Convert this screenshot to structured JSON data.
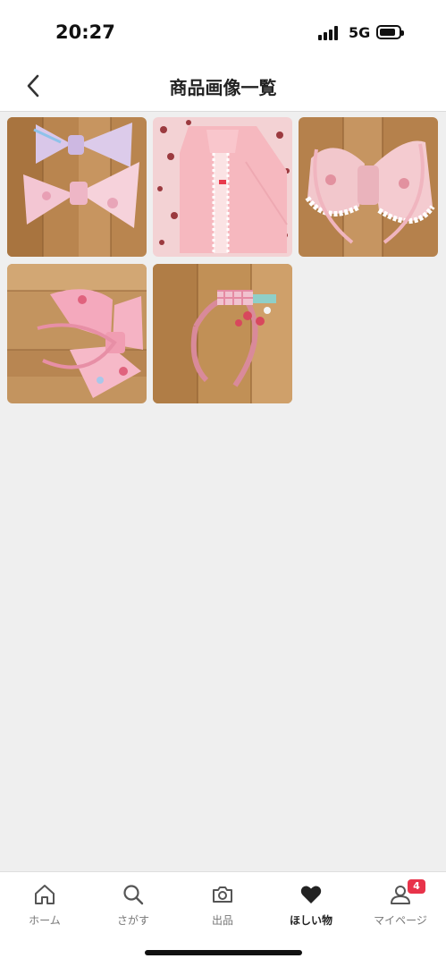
{
  "status_bar": {
    "time": "20:27",
    "network": "5G"
  },
  "header": {
    "title": "商品画像一覧",
    "back_icon": "chevron-left-icon"
  },
  "images": [
    {
      "description": "two pastel pink and lavender bows on wood"
    },
    {
      "description": "pink lace blouse on cherry print fabric"
    },
    {
      "description": "pink floral bow headband with white lace"
    },
    {
      "description": "large pink bow headband with strawberry print"
    },
    {
      "description": "pink gingham headband with strawberries"
    }
  ],
  "tab_bar": {
    "items": [
      {
        "label": "ホーム",
        "icon": "home-icon",
        "active": false
      },
      {
        "label": "さがす",
        "icon": "search-icon",
        "active": false
      },
      {
        "label": "出品",
        "icon": "camera-icon",
        "active": false
      },
      {
        "label": "ほしい物",
        "icon": "heart-icon",
        "active": true
      },
      {
        "label": "マイページ",
        "icon": "user-icon",
        "active": false,
        "badge": "4"
      }
    ]
  },
  "colors": {
    "badge": "#e8334a",
    "background": "#efefef"
  }
}
